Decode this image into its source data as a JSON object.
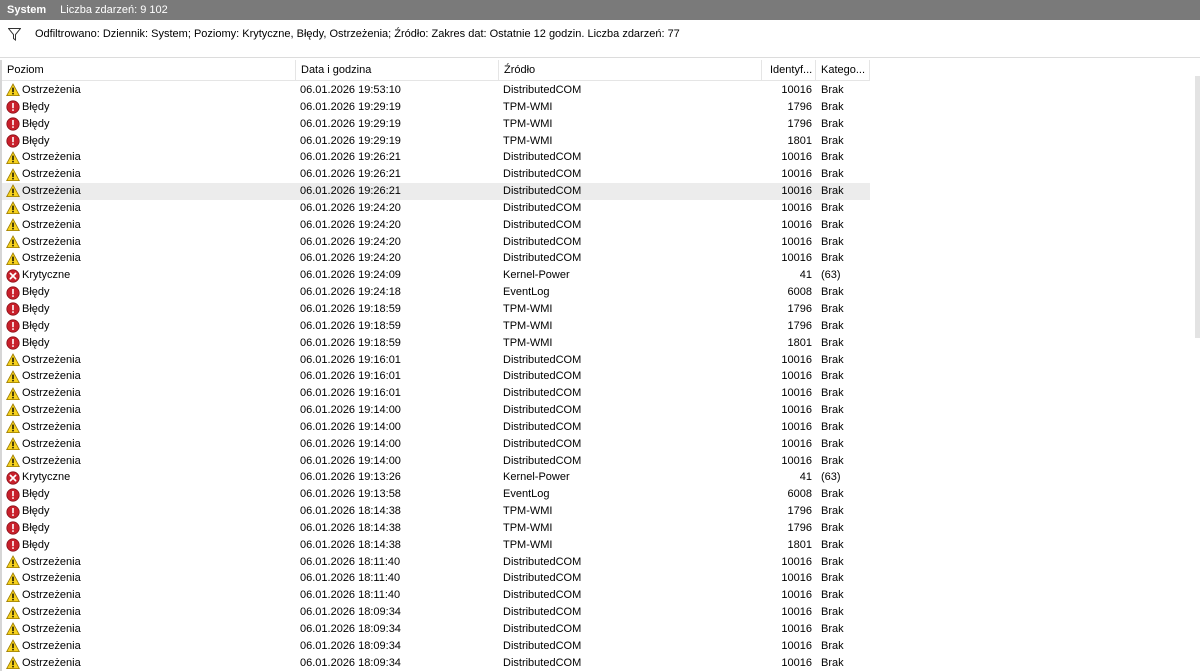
{
  "title": {
    "name": "System",
    "count": "Liczba zdarzeń: 9 102"
  },
  "filter": {
    "icon": "filter-icon",
    "text": "Odfiltrowano: Dziennik: System; Poziomy: Krytyczne, Błędy, Ostrzeżenia; Źródło: Zakres dat: Ostatnie 12 godzin. Liczba zdarzeń: 77"
  },
  "columns": {
    "level": "Poziom",
    "date": "Data i godzina",
    "source": "Źródło",
    "id": "Identyf...",
    "category": "Katego..."
  },
  "icons": {
    "warning": "warning-icon",
    "error": "error-icon",
    "critical": "critical-icon"
  },
  "colors": {
    "warning": "#f7d21d",
    "error": "#c8202b",
    "critical": "#c8202b",
    "selected_row": "#ececec",
    "titlebar": "#7a7a7a"
  },
  "selected_row_index": 6,
  "rows": [
    {
      "kind": "warning",
      "level": "Ostrzeżenia",
      "date": "06.01.2026 19:53:10",
      "source": "DistributedCOM",
      "id": "10016",
      "category": "Brak"
    },
    {
      "kind": "error",
      "level": "Błędy",
      "date": "06.01.2026 19:29:19",
      "source": "TPM-WMI",
      "id": "1796",
      "category": "Brak"
    },
    {
      "kind": "error",
      "level": "Błędy",
      "date": "06.01.2026 19:29:19",
      "source": "TPM-WMI",
      "id": "1796",
      "category": "Brak"
    },
    {
      "kind": "error",
      "level": "Błędy",
      "date": "06.01.2026 19:29:19",
      "source": "TPM-WMI",
      "id": "1801",
      "category": "Brak"
    },
    {
      "kind": "warning",
      "level": "Ostrzeżenia",
      "date": "06.01.2026 19:26:21",
      "source": "DistributedCOM",
      "id": "10016",
      "category": "Brak"
    },
    {
      "kind": "warning",
      "level": "Ostrzeżenia",
      "date": "06.01.2026 19:26:21",
      "source": "DistributedCOM",
      "id": "10016",
      "category": "Brak"
    },
    {
      "kind": "warning",
      "level": "Ostrzeżenia",
      "date": "06.01.2026 19:26:21",
      "source": "DistributedCOM",
      "id": "10016",
      "category": "Brak"
    },
    {
      "kind": "warning",
      "level": "Ostrzeżenia",
      "date": "06.01.2026 19:24:20",
      "source": "DistributedCOM",
      "id": "10016",
      "category": "Brak"
    },
    {
      "kind": "warning",
      "level": "Ostrzeżenia",
      "date": "06.01.2026 19:24:20",
      "source": "DistributedCOM",
      "id": "10016",
      "category": "Brak"
    },
    {
      "kind": "warning",
      "level": "Ostrzeżenia",
      "date": "06.01.2026 19:24:20",
      "source": "DistributedCOM",
      "id": "10016",
      "category": "Brak"
    },
    {
      "kind": "warning",
      "level": "Ostrzeżenia",
      "date": "06.01.2026 19:24:20",
      "source": "DistributedCOM",
      "id": "10016",
      "category": "Brak"
    },
    {
      "kind": "critical",
      "level": "Krytyczne",
      "date": "06.01.2026 19:24:09",
      "source": "Kernel-Power",
      "id": "41",
      "category": "(63)"
    },
    {
      "kind": "error",
      "level": "Błędy",
      "date": "06.01.2026 19:24:18",
      "source": "EventLog",
      "id": "6008",
      "category": "Brak"
    },
    {
      "kind": "error",
      "level": "Błędy",
      "date": "06.01.2026 19:18:59",
      "source": "TPM-WMI",
      "id": "1796",
      "category": "Brak"
    },
    {
      "kind": "error",
      "level": "Błędy",
      "date": "06.01.2026 19:18:59",
      "source": "TPM-WMI",
      "id": "1796",
      "category": "Brak"
    },
    {
      "kind": "error",
      "level": "Błędy",
      "date": "06.01.2026 19:18:59",
      "source": "TPM-WMI",
      "id": "1801",
      "category": "Brak"
    },
    {
      "kind": "warning",
      "level": "Ostrzeżenia",
      "date": "06.01.2026 19:16:01",
      "source": "DistributedCOM",
      "id": "10016",
      "category": "Brak"
    },
    {
      "kind": "warning",
      "level": "Ostrzeżenia",
      "date": "06.01.2026 19:16:01",
      "source": "DistributedCOM",
      "id": "10016",
      "category": "Brak"
    },
    {
      "kind": "warning",
      "level": "Ostrzeżenia",
      "date": "06.01.2026 19:16:01",
      "source": "DistributedCOM",
      "id": "10016",
      "category": "Brak"
    },
    {
      "kind": "warning",
      "level": "Ostrzeżenia",
      "date": "06.01.2026 19:14:00",
      "source": "DistributedCOM",
      "id": "10016",
      "category": "Brak"
    },
    {
      "kind": "warning",
      "level": "Ostrzeżenia",
      "date": "06.01.2026 19:14:00",
      "source": "DistributedCOM",
      "id": "10016",
      "category": "Brak"
    },
    {
      "kind": "warning",
      "level": "Ostrzeżenia",
      "date": "06.01.2026 19:14:00",
      "source": "DistributedCOM",
      "id": "10016",
      "category": "Brak"
    },
    {
      "kind": "warning",
      "level": "Ostrzeżenia",
      "date": "06.01.2026 19:14:00",
      "source": "DistributedCOM",
      "id": "10016",
      "category": "Brak"
    },
    {
      "kind": "critical",
      "level": "Krytyczne",
      "date": "06.01.2026 19:13:26",
      "source": "Kernel-Power",
      "id": "41",
      "category": "(63)"
    },
    {
      "kind": "error",
      "level": "Błędy",
      "date": "06.01.2026 19:13:58",
      "source": "EventLog",
      "id": "6008",
      "category": "Brak"
    },
    {
      "kind": "error",
      "level": "Błędy",
      "date": "06.01.2026 18:14:38",
      "source": "TPM-WMI",
      "id": "1796",
      "category": "Brak"
    },
    {
      "kind": "error",
      "level": "Błędy",
      "date": "06.01.2026 18:14:38",
      "source": "TPM-WMI",
      "id": "1796",
      "category": "Brak"
    },
    {
      "kind": "error",
      "level": "Błędy",
      "date": "06.01.2026 18:14:38",
      "source": "TPM-WMI",
      "id": "1801",
      "category": "Brak"
    },
    {
      "kind": "warning",
      "level": "Ostrzeżenia",
      "date": "06.01.2026 18:11:40",
      "source": "DistributedCOM",
      "id": "10016",
      "category": "Brak"
    },
    {
      "kind": "warning",
      "level": "Ostrzeżenia",
      "date": "06.01.2026 18:11:40",
      "source": "DistributedCOM",
      "id": "10016",
      "category": "Brak"
    },
    {
      "kind": "warning",
      "level": "Ostrzeżenia",
      "date": "06.01.2026 18:11:40",
      "source": "DistributedCOM",
      "id": "10016",
      "category": "Brak"
    },
    {
      "kind": "warning",
      "level": "Ostrzeżenia",
      "date": "06.01.2026 18:09:34",
      "source": "DistributedCOM",
      "id": "10016",
      "category": "Brak"
    },
    {
      "kind": "warning",
      "level": "Ostrzeżenia",
      "date": "06.01.2026 18:09:34",
      "source": "DistributedCOM",
      "id": "10016",
      "category": "Brak"
    },
    {
      "kind": "warning",
      "level": "Ostrzeżenia",
      "date": "06.01.2026 18:09:34",
      "source": "DistributedCOM",
      "id": "10016",
      "category": "Brak"
    },
    {
      "kind": "warning",
      "level": "Ostrzeżenia",
      "date": "06.01.2026 18:09:34",
      "source": "DistributedCOM",
      "id": "10016",
      "category": "Brak"
    }
  ]
}
